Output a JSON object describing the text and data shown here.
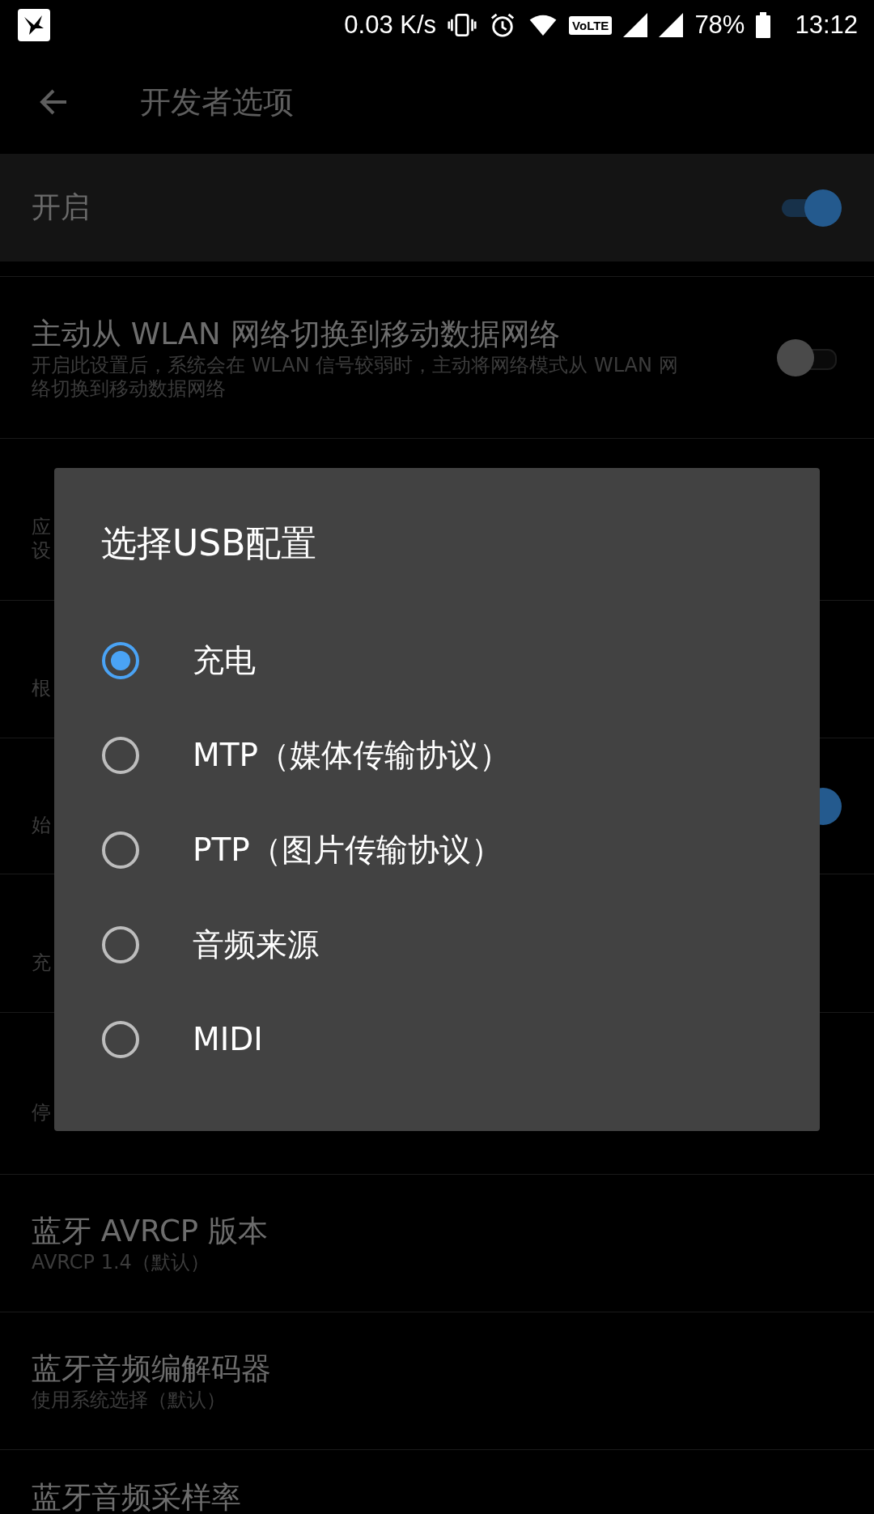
{
  "status_bar": {
    "speed": "0.03 K/s",
    "volte": "VoLTE",
    "battery": "78%",
    "time": "13:12"
  },
  "toolbar": {
    "title": "开发者选项"
  },
  "master": {
    "label": "开启",
    "on": true
  },
  "rows": [
    {
      "kind": "switch",
      "title": "主动从 WLAN 网络切换到移动数据网络",
      "description": [
        "开启此设置后，系统会在 WLAN 信号较弱时，主动将网络模式从 WLAN 网",
        "络切换到移动数据网络"
      ],
      "on": false
    },
    {
      "kind": "text",
      "description": [
        "应",
        "设"
      ]
    },
    {
      "kind": "text",
      "description": [
        "根"
      ]
    },
    {
      "kind": "switch",
      "description": [
        "始"
      ],
      "on": true
    },
    {
      "kind": "text",
      "description": [
        "充"
      ]
    },
    {
      "kind": "text",
      "description": [
        "停"
      ]
    },
    {
      "kind": "text",
      "title": "蓝牙 AVRCP 版本",
      "description": [
        "AVRCP 1.4（默认）"
      ]
    },
    {
      "kind": "text",
      "title": "蓝牙音频编解码器",
      "description": [
        "使用系统选择（默认）"
      ]
    },
    {
      "kind": "text",
      "title": "蓝牙音频采样率",
      "description": []
    }
  ],
  "dialog": {
    "title": "选择USB配置",
    "options": [
      {
        "label": "充电",
        "selected": true
      },
      {
        "label": "MTP（媒体传输协议）",
        "selected": false
      },
      {
        "label": "PTP（图片传输协议）",
        "selected": false
      },
      {
        "label": "音频来源",
        "selected": false
      },
      {
        "label": "MIDI",
        "selected": false
      }
    ]
  }
}
